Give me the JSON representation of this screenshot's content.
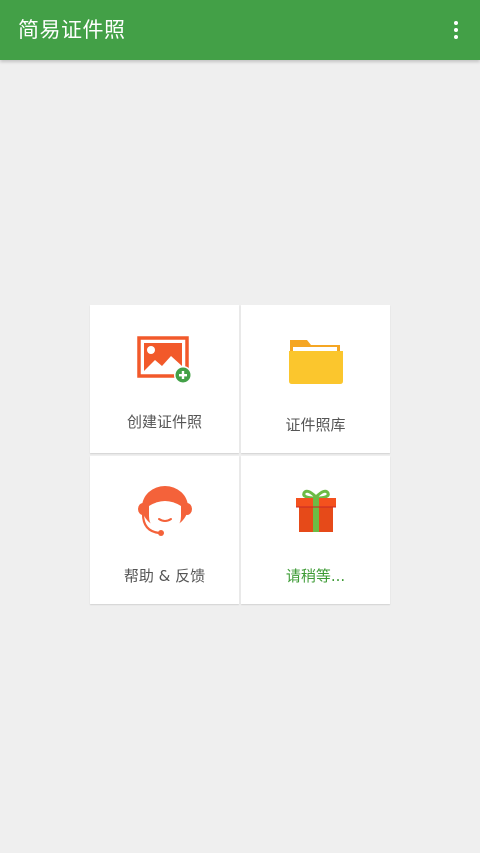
{
  "appbar": {
    "title": "简易证件照",
    "menu_icon": "more-vert-icon",
    "color": "#43a047"
  },
  "menu": {
    "items": [
      {
        "label": "创建证件照",
        "icon": "image-add-icon",
        "accent": "#f2592a"
      },
      {
        "label": "证件照库",
        "icon": "folder-icon",
        "accent": "#fbc02d"
      },
      {
        "label": "帮助 & 反馈",
        "icon": "support-agent-icon",
        "accent": "#f4623a"
      },
      {
        "label": "请稍等...",
        "icon": "gift-icon",
        "accent": "#f4511e",
        "label_color": "#3d9b35"
      }
    ]
  }
}
